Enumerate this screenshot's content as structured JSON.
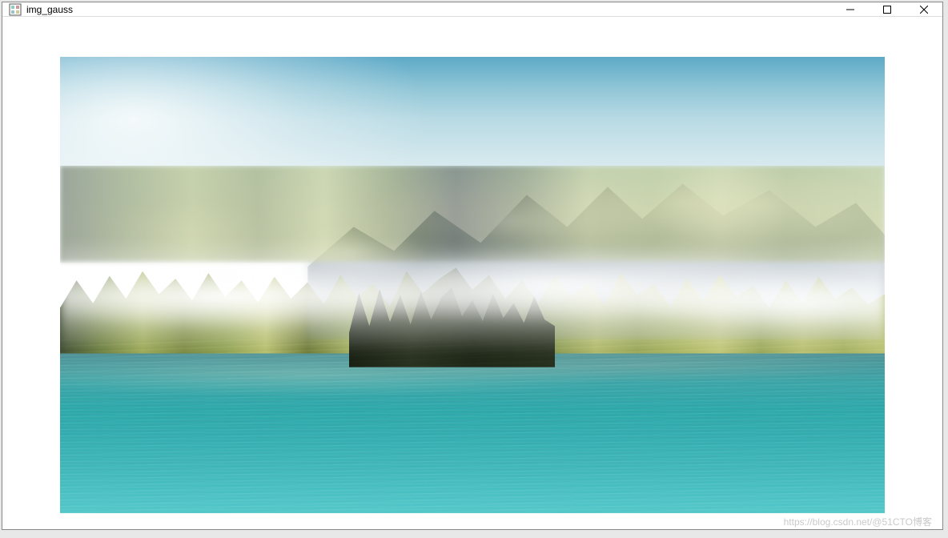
{
  "window": {
    "title": "img_gauss",
    "controls": {
      "minimize": "—",
      "maximize": "☐",
      "close": "✕"
    }
  },
  "image": {
    "description": "mountain-lake-gaussian-blur"
  },
  "watermark": "https://blog.csdn.net/@51CTO博客"
}
